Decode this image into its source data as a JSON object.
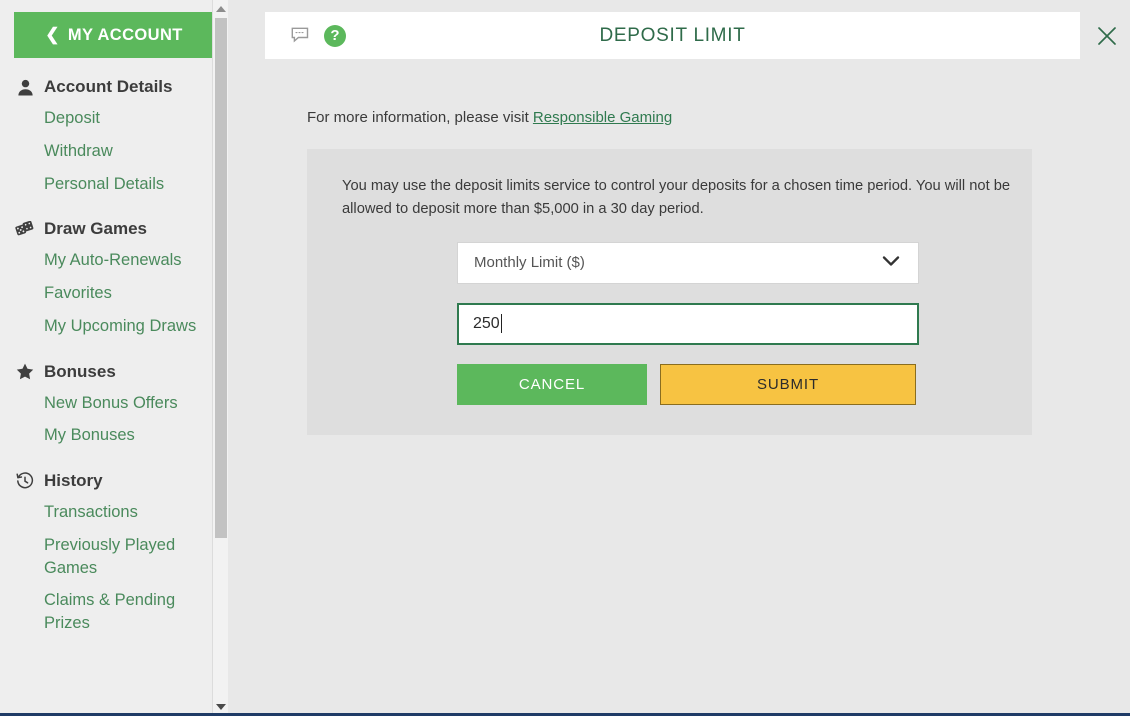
{
  "sidebar": {
    "account_button": {
      "label": "MY ACCOUNT",
      "icon": "chevron-left-icon"
    },
    "groups": [
      {
        "id": "account-details",
        "header": "Account Details",
        "icon": "user-icon",
        "items": [
          "Deposit",
          "Withdraw",
          "Personal Details"
        ]
      },
      {
        "id": "draw-games",
        "header": "Draw Games",
        "icon": "dice-icon",
        "items": [
          "My Auto-Renewals",
          "Favorites",
          "My Upcoming Draws"
        ]
      },
      {
        "id": "bonuses",
        "header": "Bonuses",
        "icon": "star-icon",
        "items": [
          "New Bonus Offers",
          "My Bonuses"
        ]
      },
      {
        "id": "history",
        "header": "History",
        "icon": "clock-history-icon",
        "items": [
          "Transactions",
          "Previously Played Games",
          "Claims & Pending Prizes"
        ]
      }
    ]
  },
  "modal": {
    "title": "DEPOSIT LIMIT",
    "chat_icon": "chat-bubble-icon",
    "help_icon": "help-question-icon",
    "close_icon": "close-icon",
    "info_prefix": "For more information, please visit ",
    "info_link": "Responsible Gaming",
    "panel_text": "You may use the deposit limits service to control your deposits for a chosen time period. You will not be allowed to deposit more than $5,000 in a 30 day period.",
    "period_select": {
      "value": "Monthly Limit ($)",
      "chevron_icon": "chevron-down-icon"
    },
    "amount_input": {
      "value": "250",
      "placeholder": ""
    },
    "cancel_label": "CANCEL",
    "submit_label": "SUBMIT"
  },
  "colors": {
    "green": "#5cb85c",
    "dark_green": "#2f7a4f",
    "amber": "#f7c342",
    "link_green": "#4a8a5c",
    "panel_gray": "#dedede",
    "page_gray": "#e8e8e8",
    "bottom_strip": "#1f3b66"
  }
}
